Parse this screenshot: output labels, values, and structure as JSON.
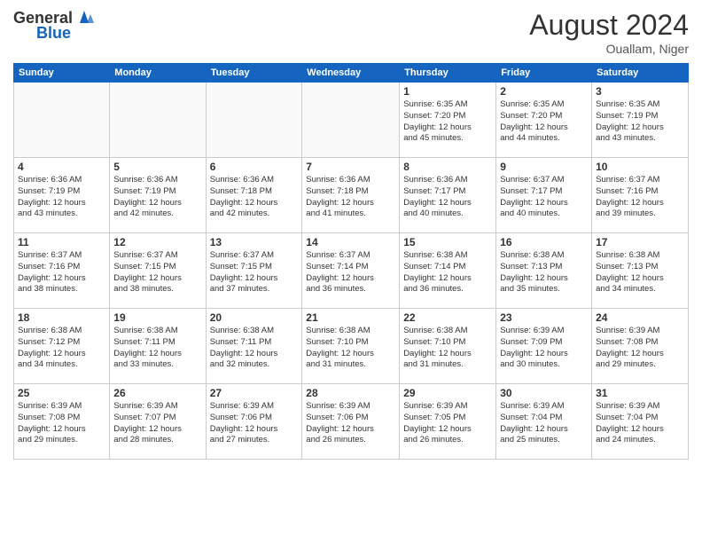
{
  "header": {
    "logo_general": "General",
    "logo_blue": "Blue",
    "month_year": "August 2024",
    "location": "Ouallam, Niger"
  },
  "weekdays": [
    "Sunday",
    "Monday",
    "Tuesday",
    "Wednesday",
    "Thursday",
    "Friday",
    "Saturday"
  ],
  "weeks": [
    [
      {
        "day": "",
        "info": ""
      },
      {
        "day": "",
        "info": ""
      },
      {
        "day": "",
        "info": ""
      },
      {
        "day": "",
        "info": ""
      },
      {
        "day": "1",
        "info": "Sunrise: 6:35 AM\nSunset: 7:20 PM\nDaylight: 12 hours\nand 45 minutes."
      },
      {
        "day": "2",
        "info": "Sunrise: 6:35 AM\nSunset: 7:20 PM\nDaylight: 12 hours\nand 44 minutes."
      },
      {
        "day": "3",
        "info": "Sunrise: 6:35 AM\nSunset: 7:19 PM\nDaylight: 12 hours\nand 43 minutes."
      }
    ],
    [
      {
        "day": "4",
        "info": "Sunrise: 6:36 AM\nSunset: 7:19 PM\nDaylight: 12 hours\nand 43 minutes."
      },
      {
        "day": "5",
        "info": "Sunrise: 6:36 AM\nSunset: 7:19 PM\nDaylight: 12 hours\nand 42 minutes."
      },
      {
        "day": "6",
        "info": "Sunrise: 6:36 AM\nSunset: 7:18 PM\nDaylight: 12 hours\nand 42 minutes."
      },
      {
        "day": "7",
        "info": "Sunrise: 6:36 AM\nSunset: 7:18 PM\nDaylight: 12 hours\nand 41 minutes."
      },
      {
        "day": "8",
        "info": "Sunrise: 6:36 AM\nSunset: 7:17 PM\nDaylight: 12 hours\nand 40 minutes."
      },
      {
        "day": "9",
        "info": "Sunrise: 6:37 AM\nSunset: 7:17 PM\nDaylight: 12 hours\nand 40 minutes."
      },
      {
        "day": "10",
        "info": "Sunrise: 6:37 AM\nSunset: 7:16 PM\nDaylight: 12 hours\nand 39 minutes."
      }
    ],
    [
      {
        "day": "11",
        "info": "Sunrise: 6:37 AM\nSunset: 7:16 PM\nDaylight: 12 hours\nand 38 minutes."
      },
      {
        "day": "12",
        "info": "Sunrise: 6:37 AM\nSunset: 7:15 PM\nDaylight: 12 hours\nand 38 minutes."
      },
      {
        "day": "13",
        "info": "Sunrise: 6:37 AM\nSunset: 7:15 PM\nDaylight: 12 hours\nand 37 minutes."
      },
      {
        "day": "14",
        "info": "Sunrise: 6:37 AM\nSunset: 7:14 PM\nDaylight: 12 hours\nand 36 minutes."
      },
      {
        "day": "15",
        "info": "Sunrise: 6:38 AM\nSunset: 7:14 PM\nDaylight: 12 hours\nand 36 minutes."
      },
      {
        "day": "16",
        "info": "Sunrise: 6:38 AM\nSunset: 7:13 PM\nDaylight: 12 hours\nand 35 minutes."
      },
      {
        "day": "17",
        "info": "Sunrise: 6:38 AM\nSunset: 7:13 PM\nDaylight: 12 hours\nand 34 minutes."
      }
    ],
    [
      {
        "day": "18",
        "info": "Sunrise: 6:38 AM\nSunset: 7:12 PM\nDaylight: 12 hours\nand 34 minutes."
      },
      {
        "day": "19",
        "info": "Sunrise: 6:38 AM\nSunset: 7:11 PM\nDaylight: 12 hours\nand 33 minutes."
      },
      {
        "day": "20",
        "info": "Sunrise: 6:38 AM\nSunset: 7:11 PM\nDaylight: 12 hours\nand 32 minutes."
      },
      {
        "day": "21",
        "info": "Sunrise: 6:38 AM\nSunset: 7:10 PM\nDaylight: 12 hours\nand 31 minutes."
      },
      {
        "day": "22",
        "info": "Sunrise: 6:38 AM\nSunset: 7:10 PM\nDaylight: 12 hours\nand 31 minutes."
      },
      {
        "day": "23",
        "info": "Sunrise: 6:39 AM\nSunset: 7:09 PM\nDaylight: 12 hours\nand 30 minutes."
      },
      {
        "day": "24",
        "info": "Sunrise: 6:39 AM\nSunset: 7:08 PM\nDaylight: 12 hours\nand 29 minutes."
      }
    ],
    [
      {
        "day": "25",
        "info": "Sunrise: 6:39 AM\nSunset: 7:08 PM\nDaylight: 12 hours\nand 29 minutes."
      },
      {
        "day": "26",
        "info": "Sunrise: 6:39 AM\nSunset: 7:07 PM\nDaylight: 12 hours\nand 28 minutes."
      },
      {
        "day": "27",
        "info": "Sunrise: 6:39 AM\nSunset: 7:06 PM\nDaylight: 12 hours\nand 27 minutes."
      },
      {
        "day": "28",
        "info": "Sunrise: 6:39 AM\nSunset: 7:06 PM\nDaylight: 12 hours\nand 26 minutes."
      },
      {
        "day": "29",
        "info": "Sunrise: 6:39 AM\nSunset: 7:05 PM\nDaylight: 12 hours\nand 26 minutes."
      },
      {
        "day": "30",
        "info": "Sunrise: 6:39 AM\nSunset: 7:04 PM\nDaylight: 12 hours\nand 25 minutes."
      },
      {
        "day": "31",
        "info": "Sunrise: 6:39 AM\nSunset: 7:04 PM\nDaylight: 12 hours\nand 24 minutes."
      }
    ]
  ]
}
